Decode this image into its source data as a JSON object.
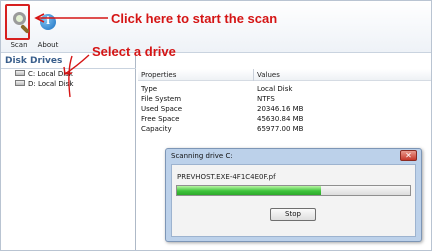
{
  "toolbar": {
    "scan_label": "Scan",
    "about_label": "About"
  },
  "annotations": {
    "scan_note": "Click here to start the scan",
    "drive_note": "Select a drive",
    "color": "#d51515"
  },
  "left_pane": {
    "title": "Disk Drives",
    "drives": [
      {
        "label": "C: Local Disk"
      },
      {
        "label": "D: Local Disk"
      }
    ]
  },
  "properties": {
    "headers": {
      "property": "Properties",
      "value": "Values"
    },
    "rows": [
      {
        "key": "Type",
        "value": "Local Disk"
      },
      {
        "key": "File System",
        "value": "NTFS"
      },
      {
        "key": "Used Space",
        "value": "20346.16 MB"
      },
      {
        "key": "Free Space",
        "value": "45630.84 MB"
      },
      {
        "key": "Capacity",
        "value": "65977.00 MB"
      }
    ]
  },
  "dialog": {
    "title": "Scanning drive C:",
    "current_file": "PREVHOST.EXE-4F1C4E0F.pf",
    "progress": 0.62,
    "stop_label": "Stop",
    "close_icon": "close-icon"
  },
  "colors": {
    "progress_green": "#3fc43b",
    "accent_blue": "#3a5f8c"
  }
}
